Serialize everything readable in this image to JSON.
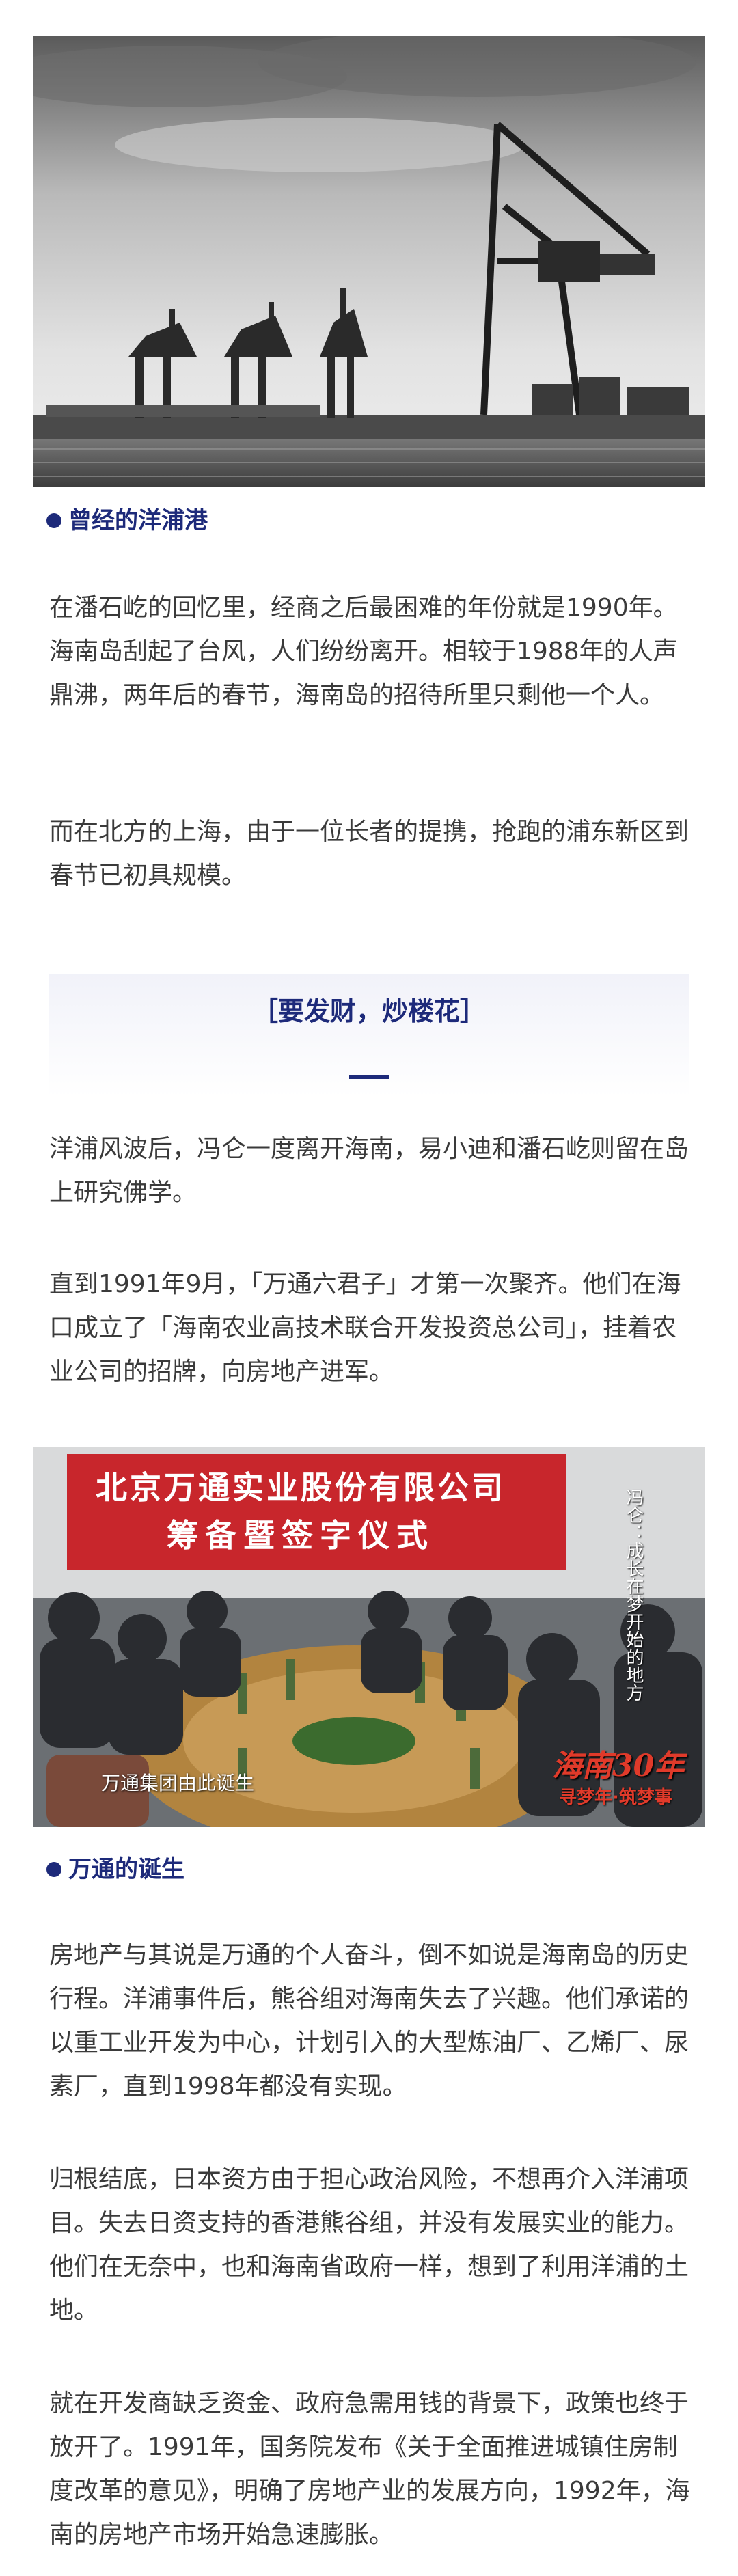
{
  "photo1": {
    "alt_icon": "port-cranes-photo"
  },
  "caption1": "曾经的洋浦港",
  "para1": "在潘石屹的回忆里，经商之后最困难的年份就是1990年。海南岛刮起了台风，人们纷纷离开。相较于1988年的人声鼎沸，两年后的春节，海南岛的招待所里只剩他一个人。",
  "para2": "而在北方的上海，由于一位长者的提携，抢跑的浦东新区到春节已初具规模。",
  "section_title": "［要发财，炒楼花］",
  "para3": "洋浦风波后，冯仑一度离开海南，易小迪和潘石屹则留在岛上研究佛学。",
  "para4": "直到1991年9月，「万通六君子」才第一次聚齐。他们在海口成立了「海南农业高技术联合开发投资总公司」，挂着农业公司的招牌，向房地产进军。",
  "photo2": {
    "banner_line1": "北京万通实业股份有限公司",
    "banner_line2": "筹备暨签字仪式",
    "subtitle": "万通集团由此诞生",
    "side_text": "冯仑：成长在梦开始的地方",
    "logo_text": "海南30年",
    "logo_sub": "寻梦年·筑梦事"
  },
  "caption2": "万通的诞生",
  "para5": "房地产与其说是万通的个人奋斗，倒不如说是海南岛的历史行程。洋浦事件后，熊谷组对海南失去了兴趣。他们承诺的以重工业开发为中心，计划引入的大型炼油厂、乙烯厂、尿素厂，直到1998年都没有实现。",
  "para6": "归根结底，日本资方由于担心政治风险，不想再介入洋浦项目。失去日资支持的香港熊谷组，并没有发展实业的能力。他们在无奈中，也和海南省政府一样，想到了利用洋浦的土地。",
  "para7": "就在开发商缺乏资金、政府急需用钱的背景下，政策也终于放开了。1991年，国务院发布《关于全面推进城镇住房制度改革的意见》，明确了房地产业的发展方向，1992年，海南的房地产市场开始急速膨胀。",
  "colors": {
    "accent": "#1d2a7a",
    "banner_red": "#c8262c"
  }
}
